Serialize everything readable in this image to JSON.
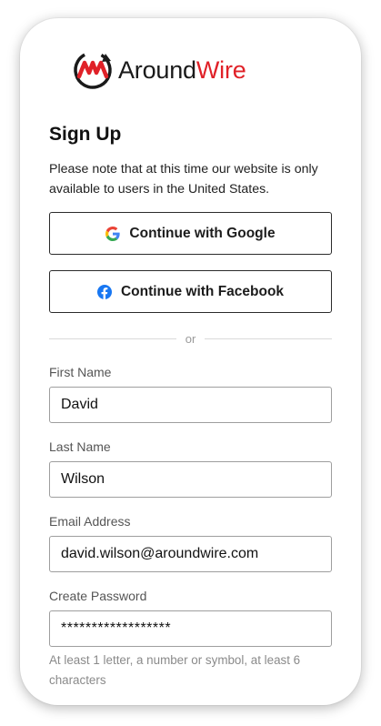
{
  "brand": {
    "name_part1": "Around",
    "name_part2": "Wire",
    "logo_icon": "aroundwire-logo-icon",
    "colors": {
      "red": "#e02128",
      "dark": "#1a1a1a"
    }
  },
  "signup": {
    "title": "Sign Up",
    "note": "Please note that at this time our website is only available to users in the United States.",
    "google_button": {
      "label": "Continue with Google",
      "icon": "google-icon"
    },
    "facebook_button": {
      "label": "Continue with Facebook",
      "icon": "facebook-icon"
    },
    "divider_text": "or"
  },
  "form": {
    "first_name": {
      "label": "First Name",
      "value": "David"
    },
    "last_name": {
      "label": "Last Name",
      "value": "Wilson"
    },
    "email": {
      "label": "Email Address",
      "value": "david.wilson@aroundwire.com"
    },
    "password": {
      "label": "Create Password",
      "value": "******************"
    },
    "password_hint": "At least 1 letter, a number or symbol, at least 6 characters"
  }
}
